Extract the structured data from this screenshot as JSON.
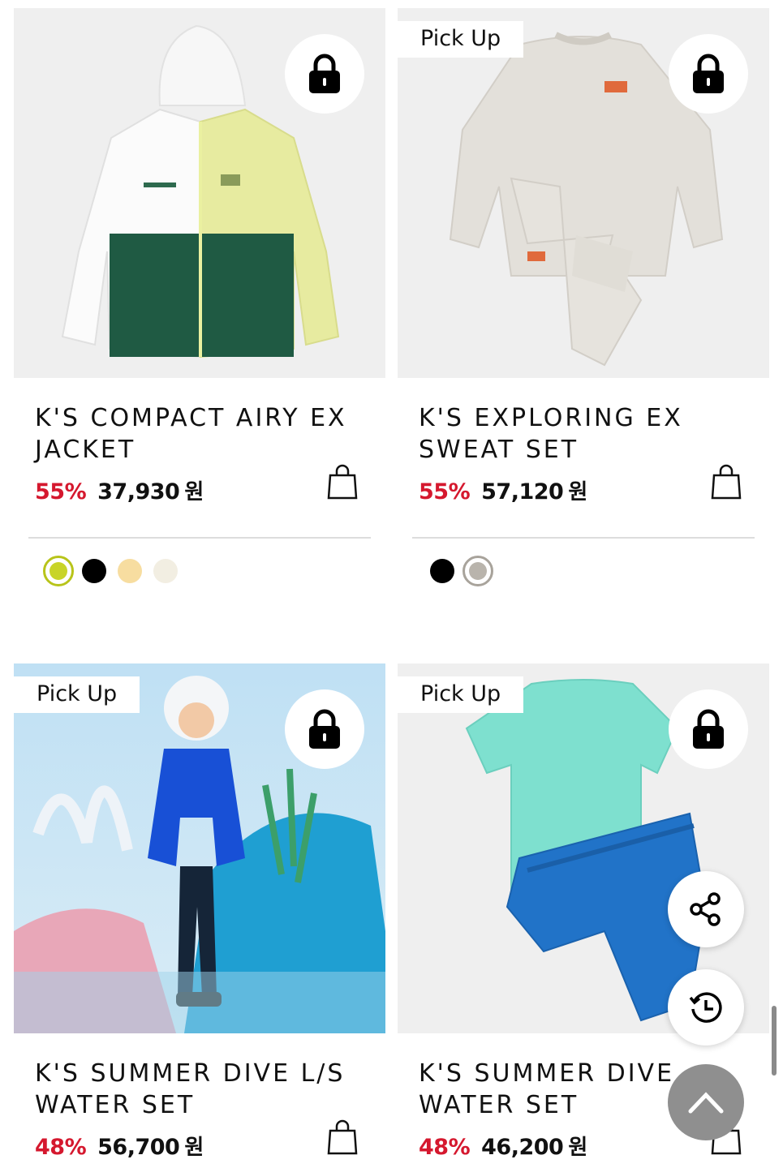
{
  "products": [
    {
      "title": "K'S COMPACT AIRY EX JACKET",
      "discount": "55%",
      "price": "37,930",
      "currency": "원",
      "pickup": "",
      "swatches": [
        "#c8d428",
        "#000000",
        "#f7dda0",
        "#f2eee2"
      ],
      "selected_swatch_ring": "#b8c41a"
    },
    {
      "title": "K'S EXPLORING EX SWEAT SET",
      "discount": "55%",
      "price": "57,120",
      "currency": "원",
      "pickup": "Pick Up",
      "swatches": [
        "#000000",
        "#b9b4ac"
      ],
      "selected_swatch_ring": "#a8a39b"
    },
    {
      "title": "K'S SUMMER DIVE L/S WATER SET",
      "discount": "48%",
      "price": "56,700",
      "currency": "원",
      "pickup": "Pick Up"
    },
    {
      "title": "K'S SUMMER DIVE WATER SET",
      "discount": "48%",
      "price": "46,200",
      "currency": "원",
      "pickup": "Pick Up"
    }
  ],
  "icons": {
    "lock": "lock-icon",
    "bag": "shopping-bag-icon",
    "share": "share-icon",
    "history": "history-icon",
    "top": "chevron-up-icon"
  },
  "colors": {
    "discount": "#d5182e",
    "image_bg": "#efefef"
  }
}
